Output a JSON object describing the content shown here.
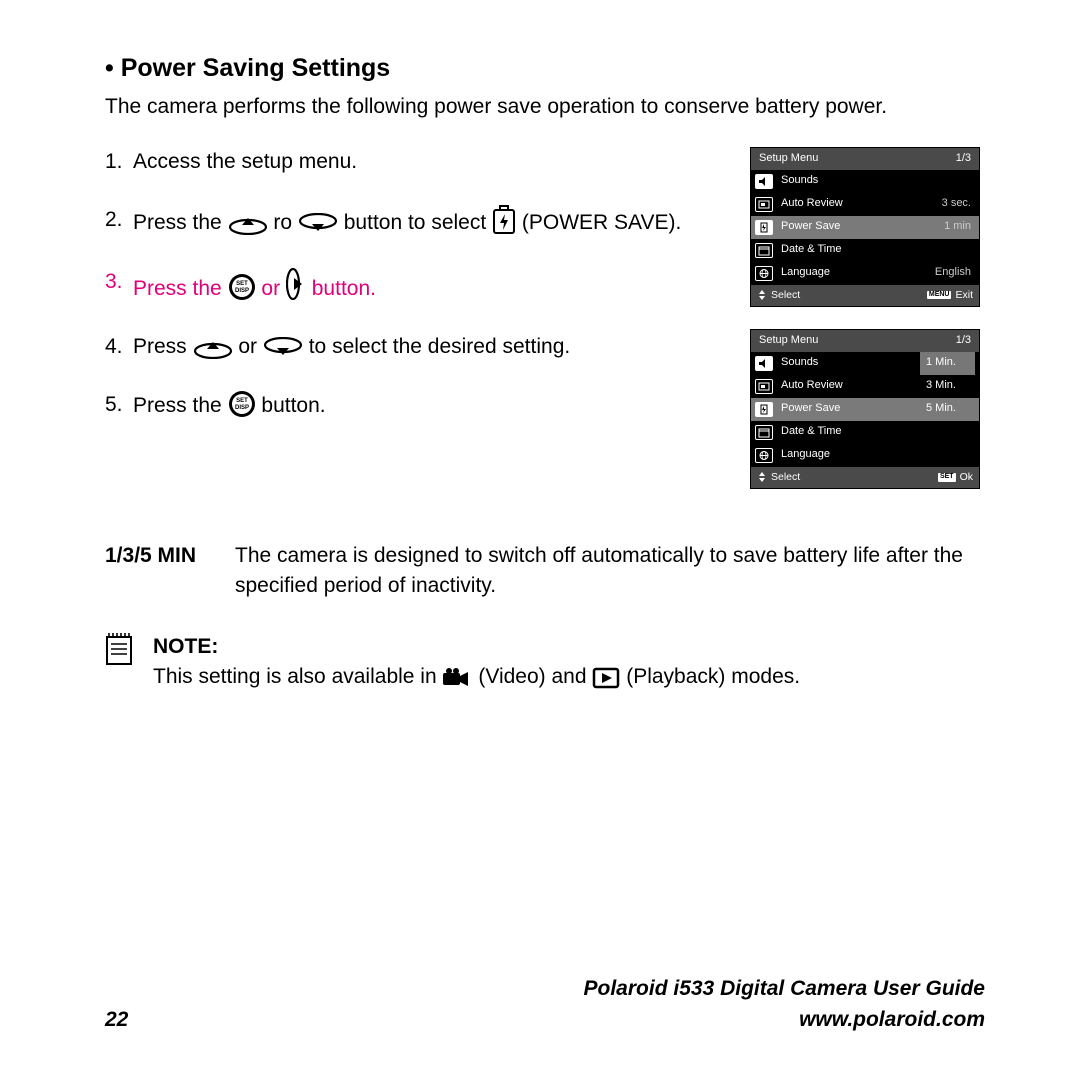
{
  "section_title": "Power Saving Settings",
  "intro": "The camera performs the following power save operation to conserve battery power.",
  "steps": {
    "s1_num": "1.",
    "s1_text": "Access the setup menu.",
    "s2_num": "2.",
    "s2_a": "Press the ",
    "s2_b": " ro ",
    "s2_c": "  button to select ",
    "s2_d": " (POWER SAVE).",
    "s3_num": "3.",
    "s3_a": "Press the ",
    "s3_b": " or ",
    "s3_c": " button.",
    "s4_num": "4.",
    "s4_a": "Press ",
    "s4_b": " or ",
    "s4_c": " to select the desired setting.",
    "s5_num": "5.",
    "s5_a": "Press the ",
    "s5_b": " button."
  },
  "lcd1": {
    "header_left": "Setup Menu",
    "header_right": "1/3",
    "rows": [
      {
        "label": "Sounds",
        "val": ""
      },
      {
        "label": "Auto Review",
        "val": "3 sec."
      },
      {
        "label": "Power Save",
        "val": "1 min"
      },
      {
        "label": "Date & Time",
        "val": ""
      },
      {
        "label": "Language",
        "val": "English"
      }
    ],
    "footer_left": "Select",
    "footer_right_badge": "MENU",
    "footer_right": "Exit"
  },
  "lcd2": {
    "header_left": "Setup Menu",
    "header_right": "1/3",
    "rows": [
      {
        "label": "Sounds",
        "sub": "1 Min."
      },
      {
        "label": "Auto Review",
        "sub": "3 Min."
      },
      {
        "label": "Power Save",
        "sub": "5 Min."
      },
      {
        "label": "Date & Time",
        "sub": ""
      },
      {
        "label": "Language",
        "sub": ""
      }
    ],
    "footer_left": "Select",
    "footer_right_badge": "SET",
    "footer_right": "Ok"
  },
  "def": {
    "label": "1/3/5 MIN",
    "body": "The camera is designed to switch off automatically to save battery life after the specified period of inactivity."
  },
  "note": {
    "label": "NOTE:",
    "a": "This setting is also available in ",
    "b": " (Video) and ",
    "c": " (Playback) modes."
  },
  "footer": {
    "page_num": "22",
    "guide": "Polaroid i533 Digital Camera User Guide",
    "url": "www.polaroid.com"
  }
}
